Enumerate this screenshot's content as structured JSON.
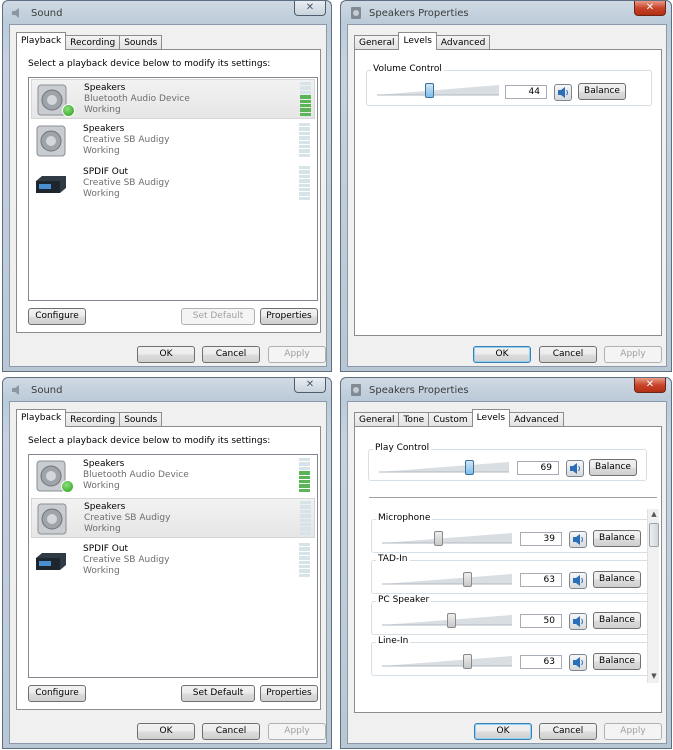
{
  "sound1": {
    "title": "Sound",
    "tabs": [
      "Playback",
      "Recording",
      "Sounds"
    ],
    "instruction": "Select a playback device below to modify its settings:",
    "devices": [
      {
        "name": "Speakers",
        "sub": "Bluetooth Audio Device",
        "status": "Working",
        "icon": "speaker-icon",
        "default": true
      },
      {
        "name": "Speakers",
        "sub": "Creative SB Audigy",
        "status": "Working",
        "icon": "speaker-icon"
      },
      {
        "name": "SPDIF Out",
        "sub": "Creative SB Audigy",
        "status": "Working",
        "icon": "spdif-device-icon"
      }
    ],
    "configure": "Configure",
    "set_default": "Set Default",
    "properties": "Properties",
    "ok": "OK",
    "cancel": "Cancel",
    "apply": "Apply"
  },
  "props1": {
    "title": "Speakers Properties",
    "tabs": [
      "General",
      "Levels",
      "Advanced"
    ],
    "volume_label": "Volume Control",
    "volume_value": "44",
    "balance": "Balance",
    "ok": "OK",
    "cancel": "Cancel",
    "apply": "Apply"
  },
  "sound2": {
    "title": "Sound",
    "tabs": [
      "Playback",
      "Recording",
      "Sounds"
    ],
    "instruction": "Select a playback device below to modify its settings:",
    "devices": [
      {
        "name": "Speakers",
        "sub": "Bluetooth Audio Device",
        "status": "Working",
        "icon": "speaker-icon",
        "default": true
      },
      {
        "name": "Speakers",
        "sub": "Creative SB Audigy",
        "status": "Working",
        "icon": "speaker-icon"
      },
      {
        "name": "SPDIF Out",
        "sub": "Creative SB Audigy",
        "status": "Working",
        "icon": "spdif-device-icon"
      }
    ],
    "configure": "Configure",
    "set_default": "Set Default",
    "properties": "Properties",
    "ok": "OK",
    "cancel": "Cancel",
    "apply": "Apply"
  },
  "props2": {
    "title": "Speakers Properties",
    "tabs": [
      "General",
      "Tone",
      "Custom",
      "Levels",
      "Advanced"
    ],
    "play_label": "Play Control",
    "play_value": "69",
    "balance": "Balance",
    "levels": [
      {
        "label": "Microphone",
        "value": "39"
      },
      {
        "label": "TAD-In",
        "value": "63"
      },
      {
        "label": "PC Speaker",
        "value": "50"
      },
      {
        "label": "Line-In",
        "value": "63"
      }
    ],
    "ok": "OK",
    "cancel": "Cancel",
    "apply": "Apply"
  },
  "colors": {
    "meter_on": "#5ab556",
    "meter_off": "#d6e4ea",
    "slider_thumb": "#7fbfe9",
    "close_red": "#c7452b"
  }
}
